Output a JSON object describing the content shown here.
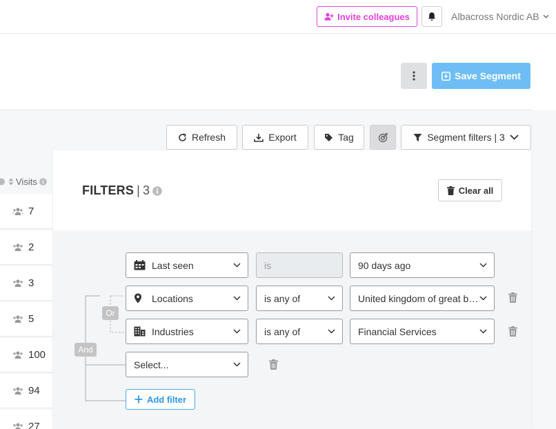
{
  "topbar": {
    "invite_label": "Invite colleagues",
    "org_name": "Albacross Nordic AB"
  },
  "header": {
    "save_segment_label": "Save Segment"
  },
  "toolbar": {
    "refresh_label": "Refresh",
    "export_label": "Export",
    "tag_label": "Tag",
    "segment_filters_label": "Segment filters | 3"
  },
  "table": {
    "visits_header": "Visits",
    "rows": [
      "7",
      "2",
      "3",
      "5",
      "100",
      "94",
      "27"
    ]
  },
  "filters": {
    "title": "FILTERS",
    "separator": "|",
    "count": "3",
    "clear_all_label": "Clear all",
    "rows": [
      {
        "field": "Last seen",
        "operator": "is",
        "value": "90 days ago"
      },
      {
        "field": "Locations",
        "operator": "is any of",
        "value": "United kingdom of great britain and northern ireland"
      },
      {
        "field": "Industries",
        "operator": "is any of",
        "value": "Financial Services"
      }
    ],
    "new_field_placeholder": "Select...",
    "and_label": "And",
    "or_label": "Or",
    "add_filter_label": "Add filter"
  },
  "colors": {
    "invite_accent": "#e63fd9",
    "save_segment_bg": "#6ebef5",
    "add_filter_accent": "#2d96e6"
  }
}
